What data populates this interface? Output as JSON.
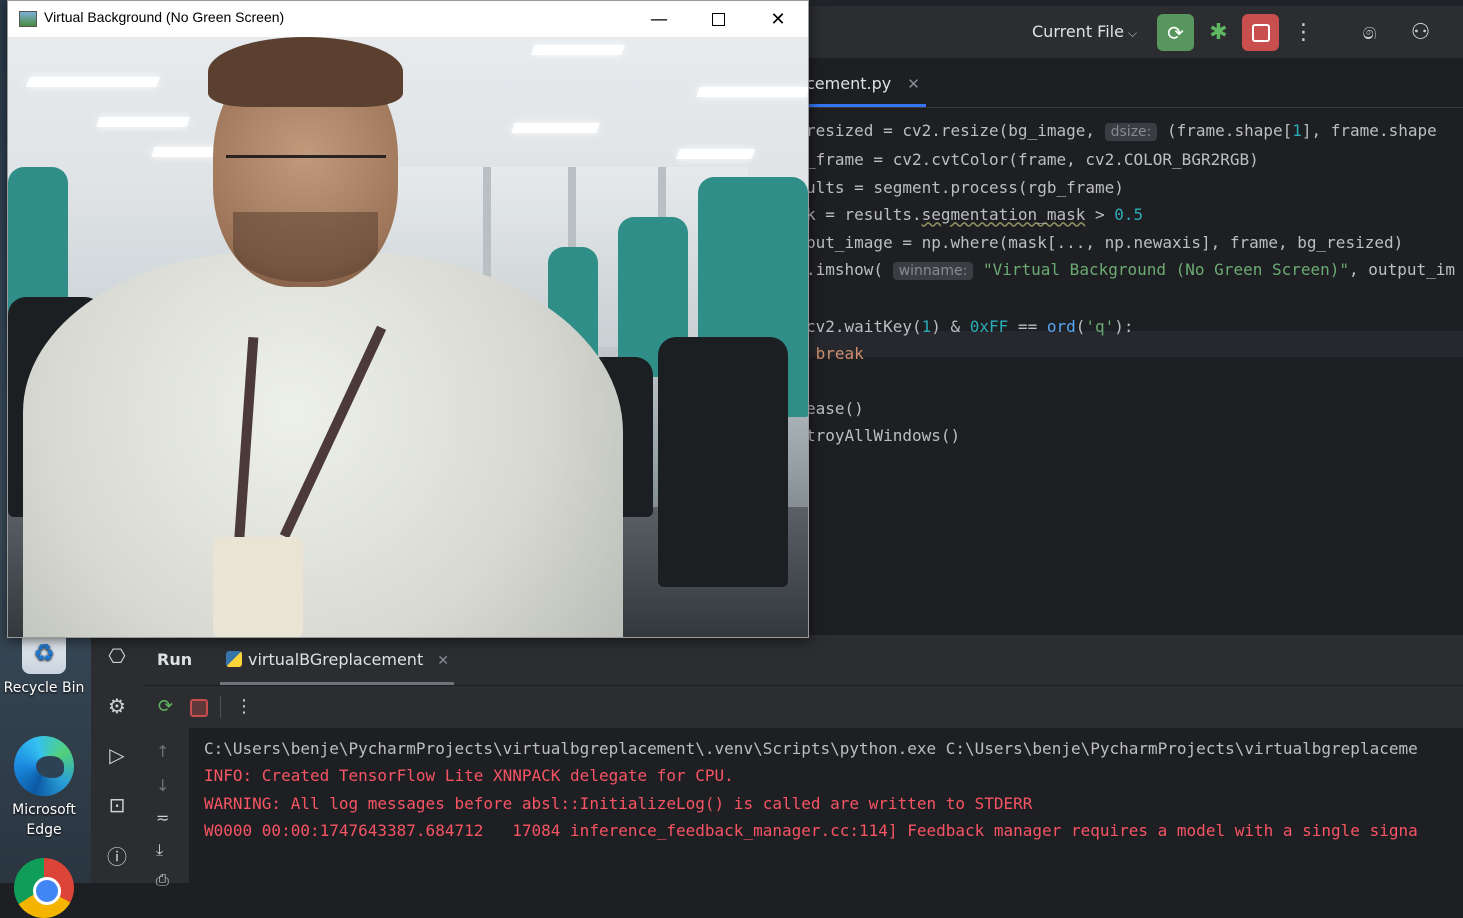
{
  "desktop": {
    "icons": [
      {
        "label": "Recycle Bin"
      },
      {
        "label": "Microsoft\nEdge",
        "line1": "Microsoft",
        "line2": "Edge"
      }
    ]
  },
  "ide": {
    "toolbar": {
      "run_config": "Current File",
      "buttons": [
        "rerun",
        "debug",
        "stop",
        "more",
        "ai-assistant",
        "add-user"
      ]
    },
    "editor_tab": {
      "label": "cement.py"
    },
    "code_lines": [
      "resized = cv2.resize(bg_image,  dsize: (frame.shape[1], frame.shape",
      "_frame = cv2.cvtColor(frame, cv2.COLOR_BGR2RGB)",
      "ults = segment.process(rgb_frame)",
      "k = results.segmentation_mask > 0.5",
      "put_image = np.where(mask[..., np.newaxis], frame, bg_resized)",
      ".imshow( winname: \"Virtual Background (No Green Screen)\", output_im",
      "",
      "cv2.waitKey(1) & 0xFF == ord('q'):",
      " break",
      "",
      "ease()",
      "troyAllWindows()"
    ],
    "code": {
      "l1_a": "resized = cv2.resize(bg_image, ",
      "l1_hint": "dsize:",
      "l1_b": " (frame.shape[",
      "l1_num": "1",
      "l1_c": "], frame.shape",
      "l2": "_frame = cv2.cvtColor(frame, cv2.COLOR_BGR2RGB)",
      "l3": "ults = segment.process(rgb_frame)",
      "l4_a": "k = results.",
      "l4_attr": "segmentation_mask",
      "l4_b": " > ",
      "l4_num": "0.5",
      "l5": "put_image = np.where(mask[..., np.newaxis], frame, bg_resized)",
      "l6_a": ".imshow( ",
      "l6_hint": "winname:",
      "l6_str": "\"Virtual Background (No Green Screen)\"",
      "l6_b": ", output_im",
      "l8_a": "cv2.waitKey(",
      "l8_num1": "1",
      "l8_b": ") & ",
      "l8_num2": "0xFF",
      "l8_c": " == ",
      "l8_fn": "ord",
      "l8_d": "(",
      "l8_str": "'q'",
      "l8_e": "):",
      "l9_kw": "break",
      "l11": "ease()",
      "l12": "troyAllWindows()"
    },
    "run_panel": {
      "title": "Run",
      "tab_label": "virtualBGreplacement",
      "console_lines": [
        {
          "text": "C:\\Users\\benje\\PycharmProjects\\virtualbgreplacement\\.venv\\Scripts\\python.exe C:\\Users\\benje\\PycharmProjects\\virtualbgreplaceme",
          "kind": "cmd"
        },
        {
          "text": "INFO: Created TensorFlow Lite XNNPACK delegate for CPU.",
          "kind": "err"
        },
        {
          "text": "WARNING: All log messages before absl::InitializeLog() is called are written to STDERR",
          "kind": "err"
        },
        {
          "text": "W0000 00:00:1747643387.684712   17084 inference_feedback_manager.cc:114] Feedback manager requires a model with a single signa",
          "kind": "err"
        }
      ]
    }
  },
  "camera_window": {
    "title": "Virtual Background (No Green Screen)",
    "controls": [
      "minimize",
      "maximize",
      "close"
    ]
  },
  "colors": {
    "ide_bg": "#1e1f22",
    "panel_bg": "#2b2d30",
    "accent_blue": "#3574f0",
    "run_green": "#57965c",
    "stop_red": "#c94f4f",
    "error_text": "#f75464",
    "string_green": "#6aab73",
    "number_teal": "#2aacb8",
    "keyword_orange": "#cf8e6d"
  }
}
